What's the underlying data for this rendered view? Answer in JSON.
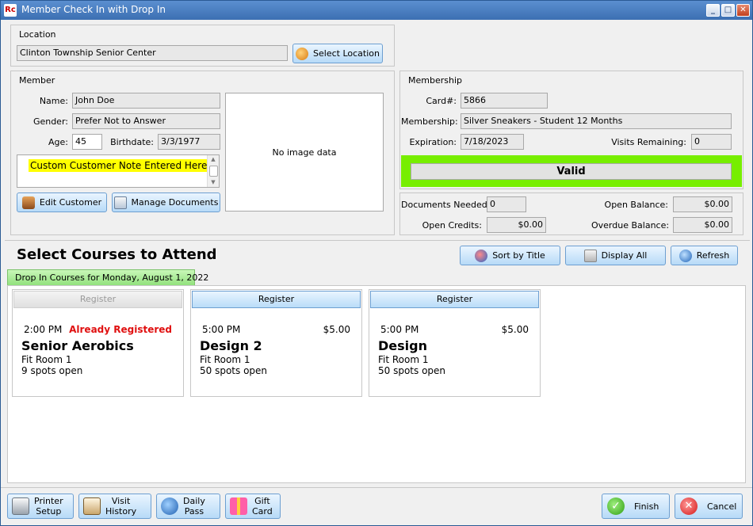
{
  "window": {
    "title": "Member Check In with Drop In",
    "app_icon": "Rc"
  },
  "location": {
    "heading": "Location",
    "value": "Clinton Township Senior Center",
    "select_button": "Select Location"
  },
  "member": {
    "heading": "Member",
    "name_label": "Name:",
    "name": "John Doe",
    "gender_label": "Gender:",
    "gender": "Prefer Not to Answer",
    "age_label": "Age:",
    "age": "45",
    "birthdate_label": "Birthdate:",
    "birthdate": "3/3/1977",
    "note": "Custom Customer Note Entered Here",
    "photo_text": "No image data",
    "edit_button": "Edit Customer",
    "documents_button": "Manage Documents"
  },
  "membership": {
    "heading": "Membership",
    "card_label": "Card#:",
    "card": "5866",
    "membership_label": "Membership:",
    "membership": "Silver Sneakers - Student 12 Months",
    "expiration_label": "Expiration:",
    "expiration": "7/18/2023",
    "visits_label": "Visits Remaining:",
    "visits": "0",
    "status": "Valid",
    "status_color": "#77ee00"
  },
  "balances": {
    "documents_label": "Documents Needed:",
    "documents": "0",
    "open_balance_label": "Open Balance:",
    "open_balance": "$0.00",
    "open_credits_label": "Open Credits:",
    "open_credits": "$0.00",
    "overdue_label": "Overdue Balance:",
    "overdue": "$0.00"
  },
  "courses": {
    "heading": "Select Courses to Attend",
    "sort_button": "Sort by Title",
    "display_button": "Display All",
    "refresh_button": "Refresh",
    "tab": "Drop In Courses for Monday, August 1, 2022",
    "items": [
      {
        "register": "Register",
        "time": "2:00 PM",
        "info": "Already Registered",
        "name": "Senior Aerobics",
        "room": "Fit Room 1",
        "spots": "9 spots open"
      },
      {
        "register": "Register",
        "time": "5:00 PM",
        "info": "$5.00",
        "name": "Design 2",
        "room": "Fit Room 1",
        "spots": "50 spots open"
      },
      {
        "register": "Register",
        "time": "5:00 PM",
        "info": "$5.00",
        "name": "Design",
        "room": "Fit Room 1",
        "spots": "50 spots open"
      }
    ]
  },
  "footer": {
    "printer_l1": "Printer",
    "printer_l2": "Setup",
    "visit_l1": "Visit",
    "visit_l2": "History",
    "daily_l1": "Daily",
    "daily_l2": "Pass",
    "gift_l1": "Gift",
    "gift_l2": "Card",
    "finish": "Finish",
    "cancel": "Cancel"
  }
}
